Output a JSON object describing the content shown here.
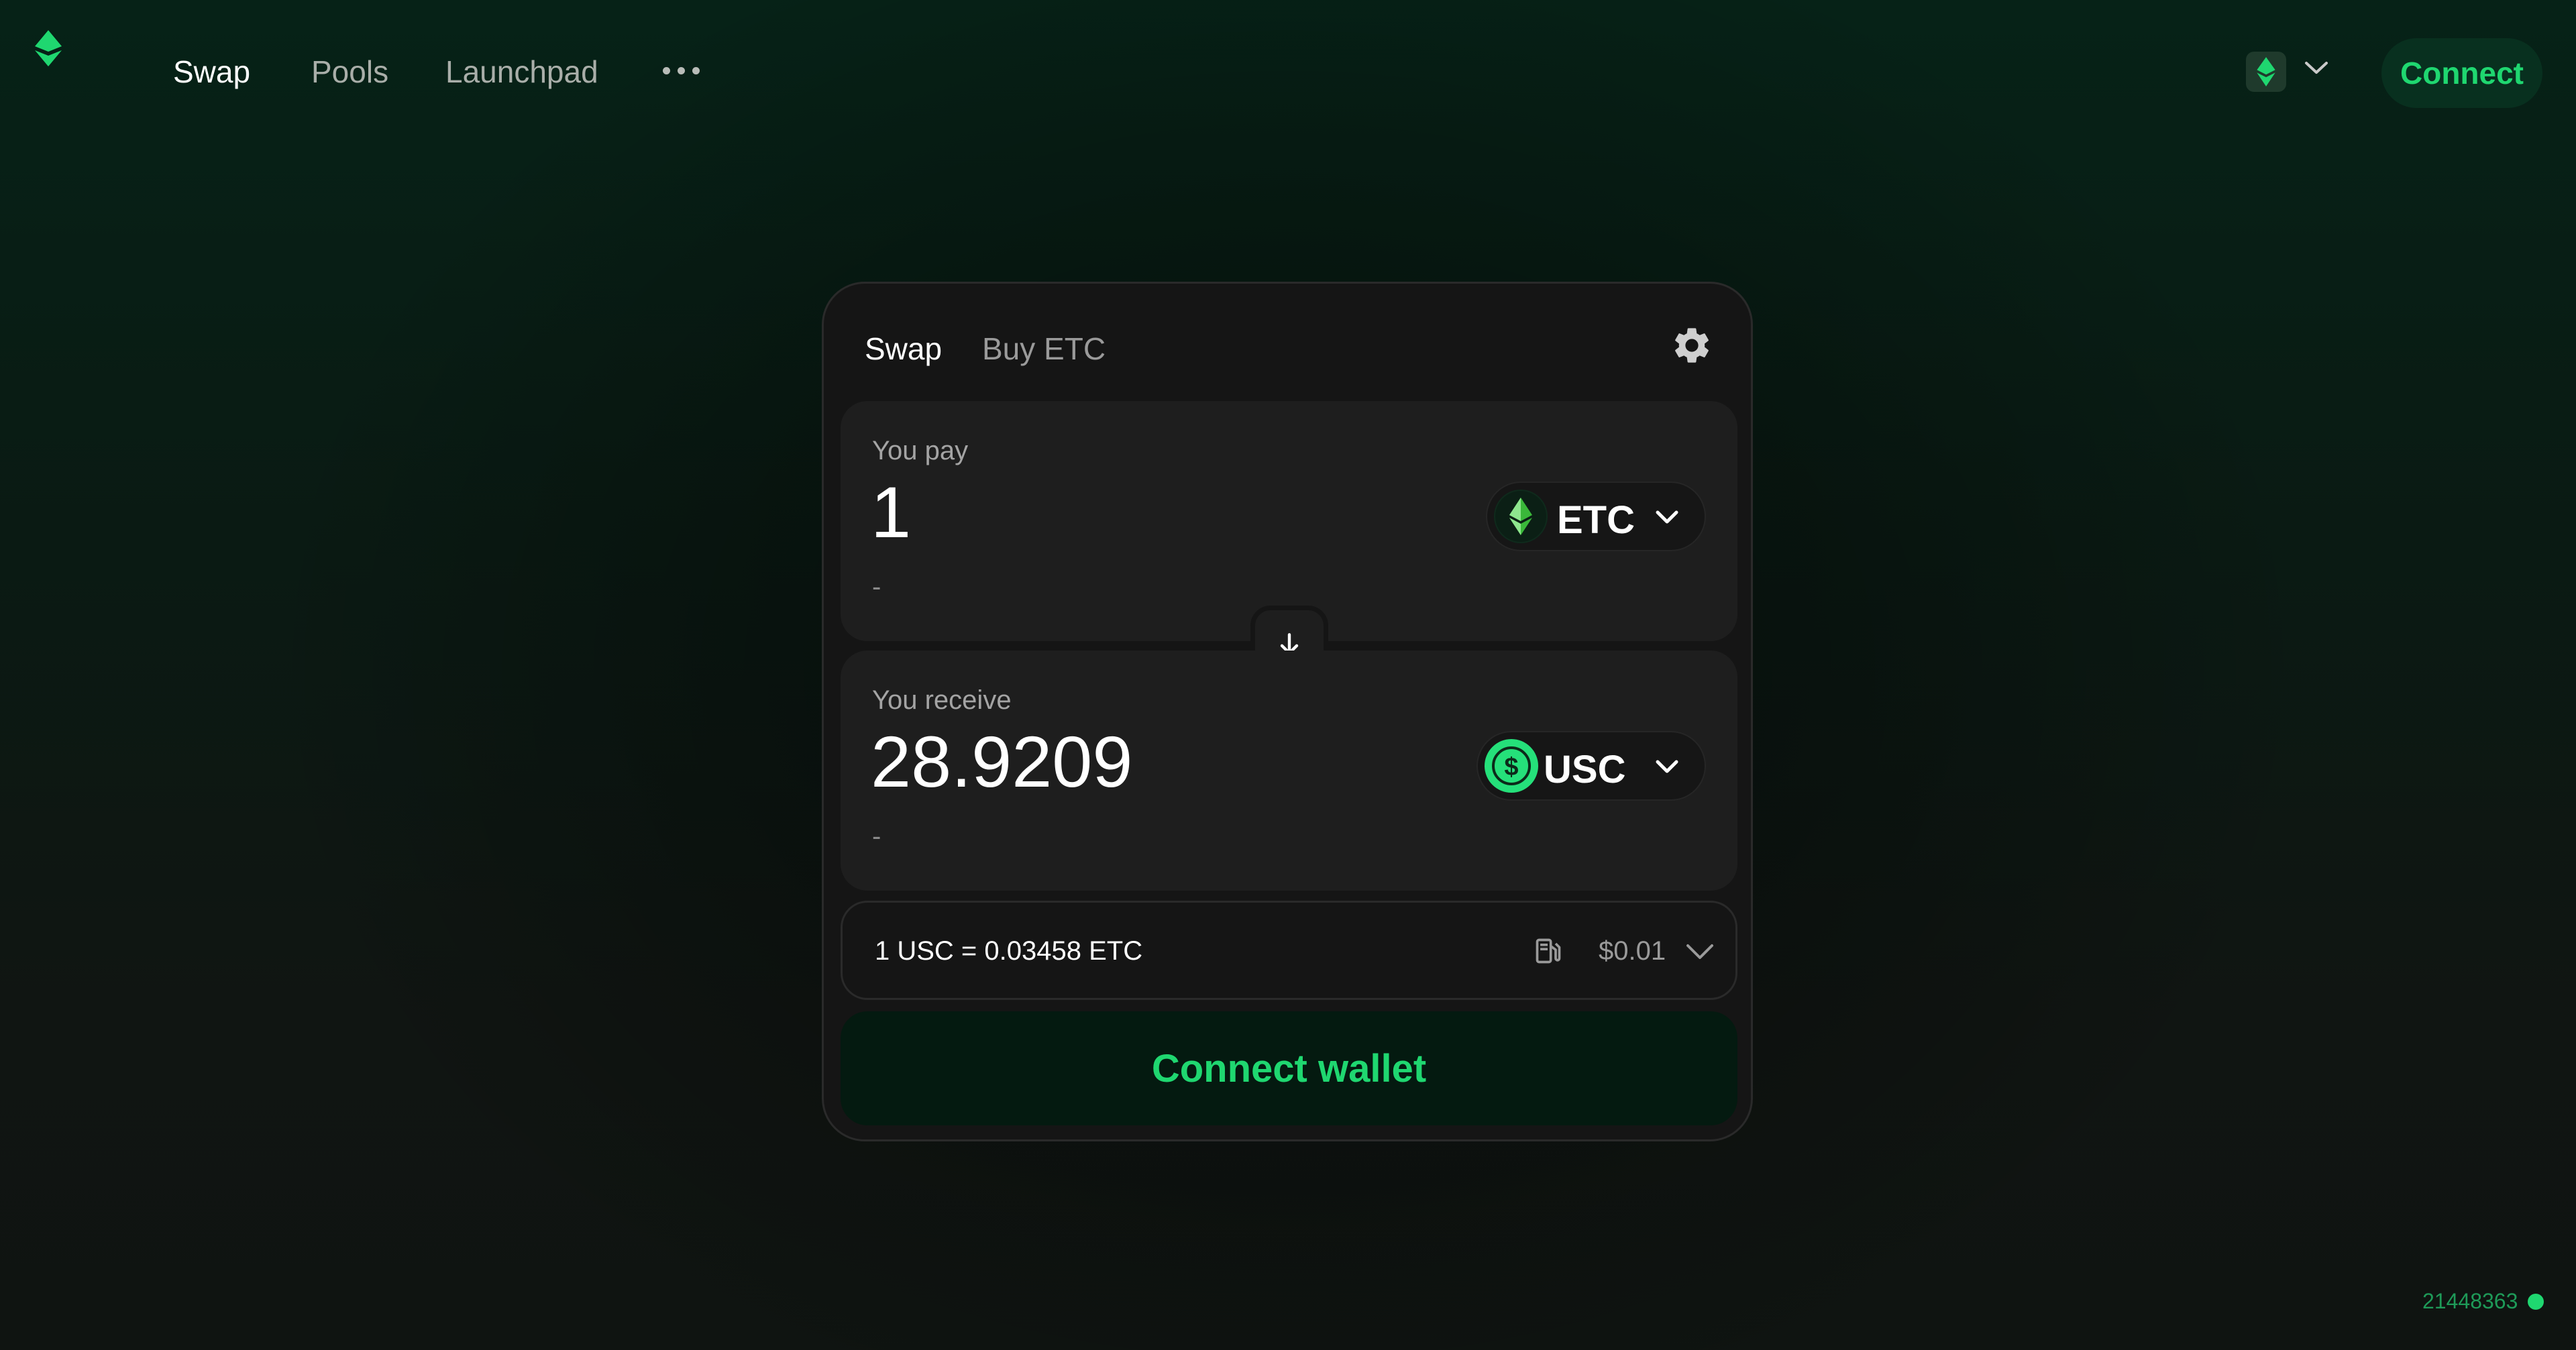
{
  "nav": {
    "logo_icon": "etc-logo-icon",
    "links": [
      {
        "label": "Swap",
        "active": true
      },
      {
        "label": "Pools",
        "active": false
      },
      {
        "label": "Launchpad",
        "active": false
      }
    ],
    "more_icon": "ellipsis-icon",
    "network_icon": "etc-network-icon",
    "connect_label": "Connect"
  },
  "swap_card": {
    "tabs": [
      {
        "label": "Swap",
        "active": true
      },
      {
        "label": "Buy ETC",
        "active": false
      }
    ],
    "settings_icon": "gear-icon",
    "pay": {
      "label": "You pay",
      "amount": "1",
      "usd_value": "-",
      "token": {
        "symbol": "ETC",
        "icon": "etc-token-icon"
      }
    },
    "flip_icon": "arrow-down-icon",
    "receive": {
      "label": "You receive",
      "amount": "28.9209",
      "usd_value": "-",
      "token": {
        "symbol": "USC",
        "icon": "usc-token-icon"
      }
    },
    "rate": {
      "text": "1 USC = 0.03458 ETC",
      "gas_icon": "gas-pump-icon",
      "gas_value": "$0.01"
    },
    "connect_wallet_label": "Connect wallet"
  },
  "footer": {
    "block_number": "21448363"
  },
  "colors": {
    "accent": "#1fd770",
    "card_bg": "#151515",
    "panel_bg": "#1e1e1e"
  }
}
